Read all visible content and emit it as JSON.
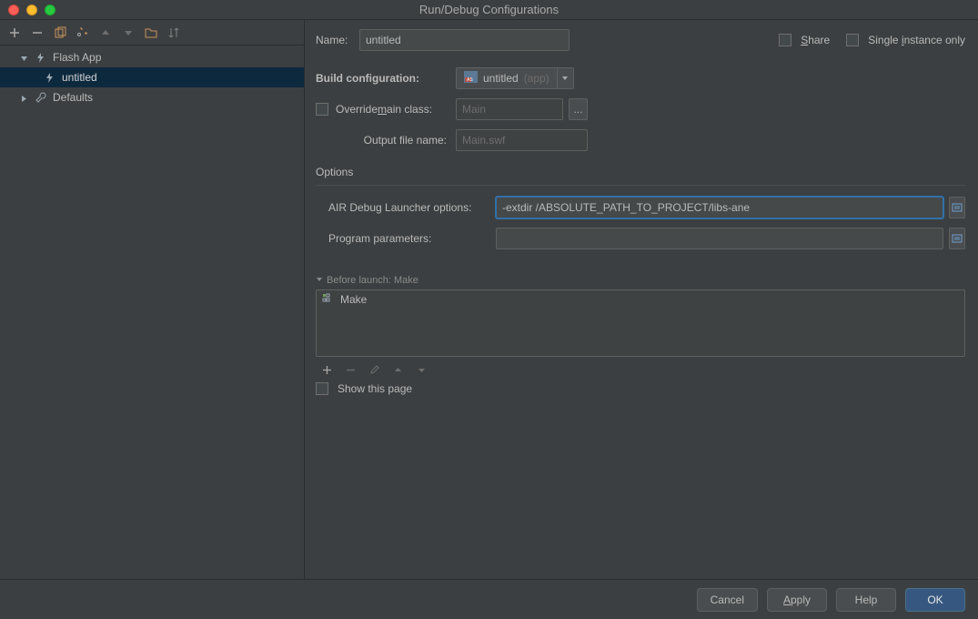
{
  "window": {
    "title": "Run/Debug Configurations"
  },
  "sidebar": {
    "items": [
      {
        "label": "Flash App"
      },
      {
        "label": "untitled"
      },
      {
        "label": "Defaults"
      }
    ]
  },
  "form": {
    "name_label": "Name:",
    "name_value": "untitled",
    "share_label": "Share",
    "single_instance_label": "Single instance only",
    "build_config_label": "Build configuration:",
    "build_config_value": "untitled",
    "build_config_suffix": "(app)",
    "override_label_pre": "Override ",
    "override_label_u": "m",
    "override_label_post": "ain class:",
    "main_class_placeholder": "Main",
    "output_file_label": "Output file name:",
    "output_file_placeholder": "Main.swf",
    "options_label": "Options",
    "adl_label": "AIR Debug Launcher options:",
    "adl_value": "-extdir /ABSOLUTE_PATH_TO_PROJECT/libs-ane",
    "program_params_label": "Program parameters:",
    "program_params_value": "",
    "before_launch_label": "Before launch: Make",
    "make_item": "Make",
    "show_this_page_label": "Show this page"
  },
  "buttons": {
    "cancel": "Cancel",
    "apply": "Apply",
    "help": "Help",
    "ok": "OK"
  }
}
